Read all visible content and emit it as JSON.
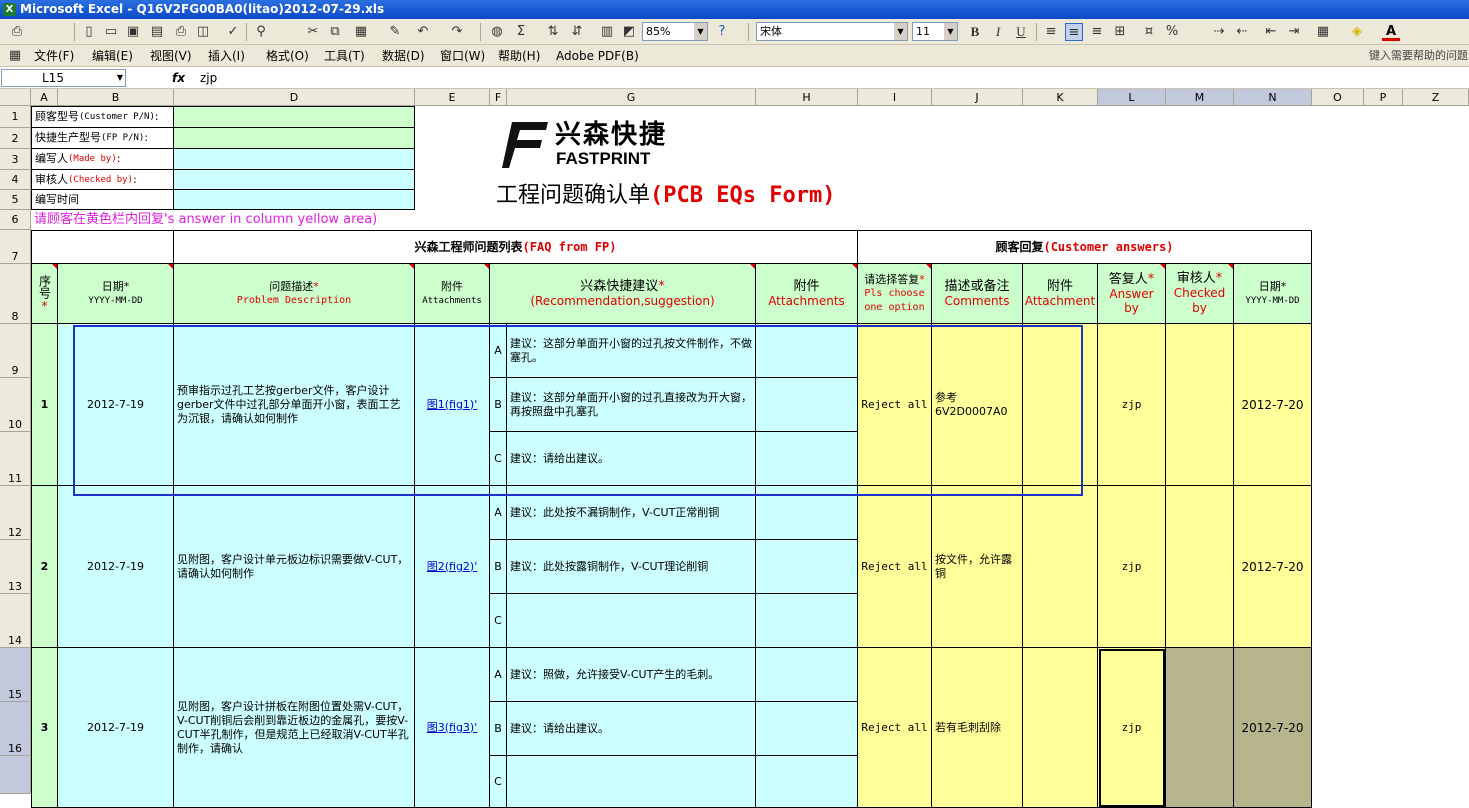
{
  "window": {
    "title": "Microsoft Excel - Q16V2FG00BA0(litao)2012-07-29.xls",
    "app_icon": "excel-icon"
  },
  "toolbar": {
    "zoom": "85%",
    "font_name": "宋体",
    "font_size": "11",
    "bold": "B",
    "italic": "I",
    "underline": "U",
    "percent": "%",
    "font_color_letter": "A"
  },
  "menu": {
    "items": [
      "文件(F)",
      "编辑(E)",
      "视图(V)",
      "插入(I)",
      "格式(O)",
      "工具(T)",
      "数据(D)",
      "窗口(W)",
      "帮助(H)",
      "Adobe PDF(B)"
    ],
    "help_placeholder": "键入需要帮助的问题"
  },
  "formula_bar": {
    "name_box": "L15",
    "fx": "fx",
    "value": "zjp"
  },
  "columns": [
    "A",
    "B",
    "D",
    "E",
    "F",
    "G",
    "H",
    "I",
    "J",
    "K",
    "L",
    "M",
    "N",
    "O",
    "P",
    "Z"
  ],
  "rows": [
    "1",
    "2",
    "3",
    "4",
    "5",
    "6",
    "7",
    "8",
    "9",
    "10",
    "11",
    "12",
    "13",
    "14",
    "15",
    "16"
  ],
  "logo": {
    "cn": "兴森快捷",
    "en": "FASTPRINT"
  },
  "form_title": {
    "cn": "工程问题确认单",
    "en": "(PCB EQs Form)"
  },
  "info_labels": [
    {
      "cn": "顾客型号",
      "en": "(Customer P/N)",
      "tail": ":"
    },
    {
      "cn": "快捷生产型号",
      "en": "(FP P/N)",
      "tail": ":"
    },
    {
      "cn": "编写人",
      "en": "(Made by)",
      "tail": ":"
    },
    {
      "cn": "审核人",
      "en": "(Checked by)",
      "tail": ":"
    },
    {
      "cn": "编写时间",
      "en": "",
      "tail": ""
    }
  ],
  "row6_note": "请顾客在黄色栏内回复's answer in column yellow area)",
  "section_fp": {
    "cn": "兴森工程师问题列表",
    "en": "(FAQ from FP)"
  },
  "section_cust": {
    "cn": "顾客回复",
    "en": "(Customer answers)"
  },
  "headers": {
    "seq": {
      "cn": "序号",
      "star": "*"
    },
    "date": {
      "cn": "日期*",
      "en": "YYYY-MM-DD"
    },
    "problem": {
      "cn": "问题描述",
      "star": "*",
      "en": "Problem Description"
    },
    "attach1": {
      "cn": "附件",
      "en": "Attachments"
    },
    "suggest": {
      "cn": "兴森快捷建议",
      "star": "*",
      "en": "(Recommendation,suggestion)"
    },
    "attach2": {
      "cn": "附件",
      "en": "Attachments"
    },
    "choose": {
      "cn": "请选择答复",
      "star": "*",
      "en": "Pls choose one option"
    },
    "comments": {
      "cn": "描述或备注",
      "en": "Comments"
    },
    "attach3": {
      "cn": "附件",
      "en": "Attachment"
    },
    "answer_by": {
      "cn": "答复人",
      "star": "*",
      "en": "Answer by"
    },
    "checked_by": {
      "cn": "审核人",
      "star": "*",
      "en": "Checked by"
    },
    "date2": {
      "cn": "日期*",
      "en": "YYYY-MM-DD"
    }
  },
  "entries": [
    {
      "seq": "1",
      "date": "2012-7-19",
      "problem": "预审指示过孔工艺按gerber文件，客户设计gerber文件中过孔部分单面开小窗，表面工艺为沉银，请确认如何制作",
      "attach": "图1(fig1)'",
      "options": [
        {
          "letter": "A",
          "text": "建议：这部分单面开小窗的过孔按文件制作，不做塞孔。"
        },
        {
          "letter": "B",
          "text": "建议：这部分单面开小窗的过孔直接改为开大窗，再按照盘中孔塞孔"
        },
        {
          "letter": "C",
          "text": "建议：请给出建议。"
        }
      ],
      "choice": "Reject all",
      "comment": "参考6V2D0007A0",
      "answer_by": "zjp",
      "date2": "2012-7-20"
    },
    {
      "seq": "2",
      "date": "2012-7-19",
      "problem": "见附图，客户设计单元板边标识需要做V-CUT，请确认如何制作",
      "attach": "图2(fig2)'",
      "options": [
        {
          "letter": "A",
          "text": "建议：此处按不漏铜制作，V-CUT正常削铜"
        },
        {
          "letter": "B",
          "text": "建议：此处按露铜制作，V-CUT理论削铜"
        },
        {
          "letter": "C",
          "text": ""
        }
      ],
      "choice": "Reject all",
      "comment": "按文件，允许露铜",
      "answer_by": "zjp",
      "date2": "2012-7-20"
    },
    {
      "seq": "3",
      "date": "2012-7-19",
      "problem": "见附图，客户设计拼板在附图位置处需V-CUT，V-CUT削铜后会削到靠近板边的金属孔，要按V-CUT半孔制作，但是规范上已经取消V-CUT半孔制作，请确认",
      "attach": "图3(fig3)'",
      "options": [
        {
          "letter": "A",
          "text": "建议：照做，允许接受V-CUT产生的毛刺。"
        },
        {
          "letter": "B",
          "text": "建议：请给出建议。"
        },
        {
          "letter": "C",
          "text": ""
        }
      ],
      "choice": "Reject all",
      "comment": "若有毛刺刮除",
      "answer_by": "zjp",
      "date2": "2012-7-20"
    }
  ],
  "colors": {
    "green": "#ccffcc",
    "cyan": "#ccffff",
    "yellow": "#ffff99",
    "olive": "#b6b58c",
    "red": "#e00000",
    "selection": "#2030cc"
  }
}
